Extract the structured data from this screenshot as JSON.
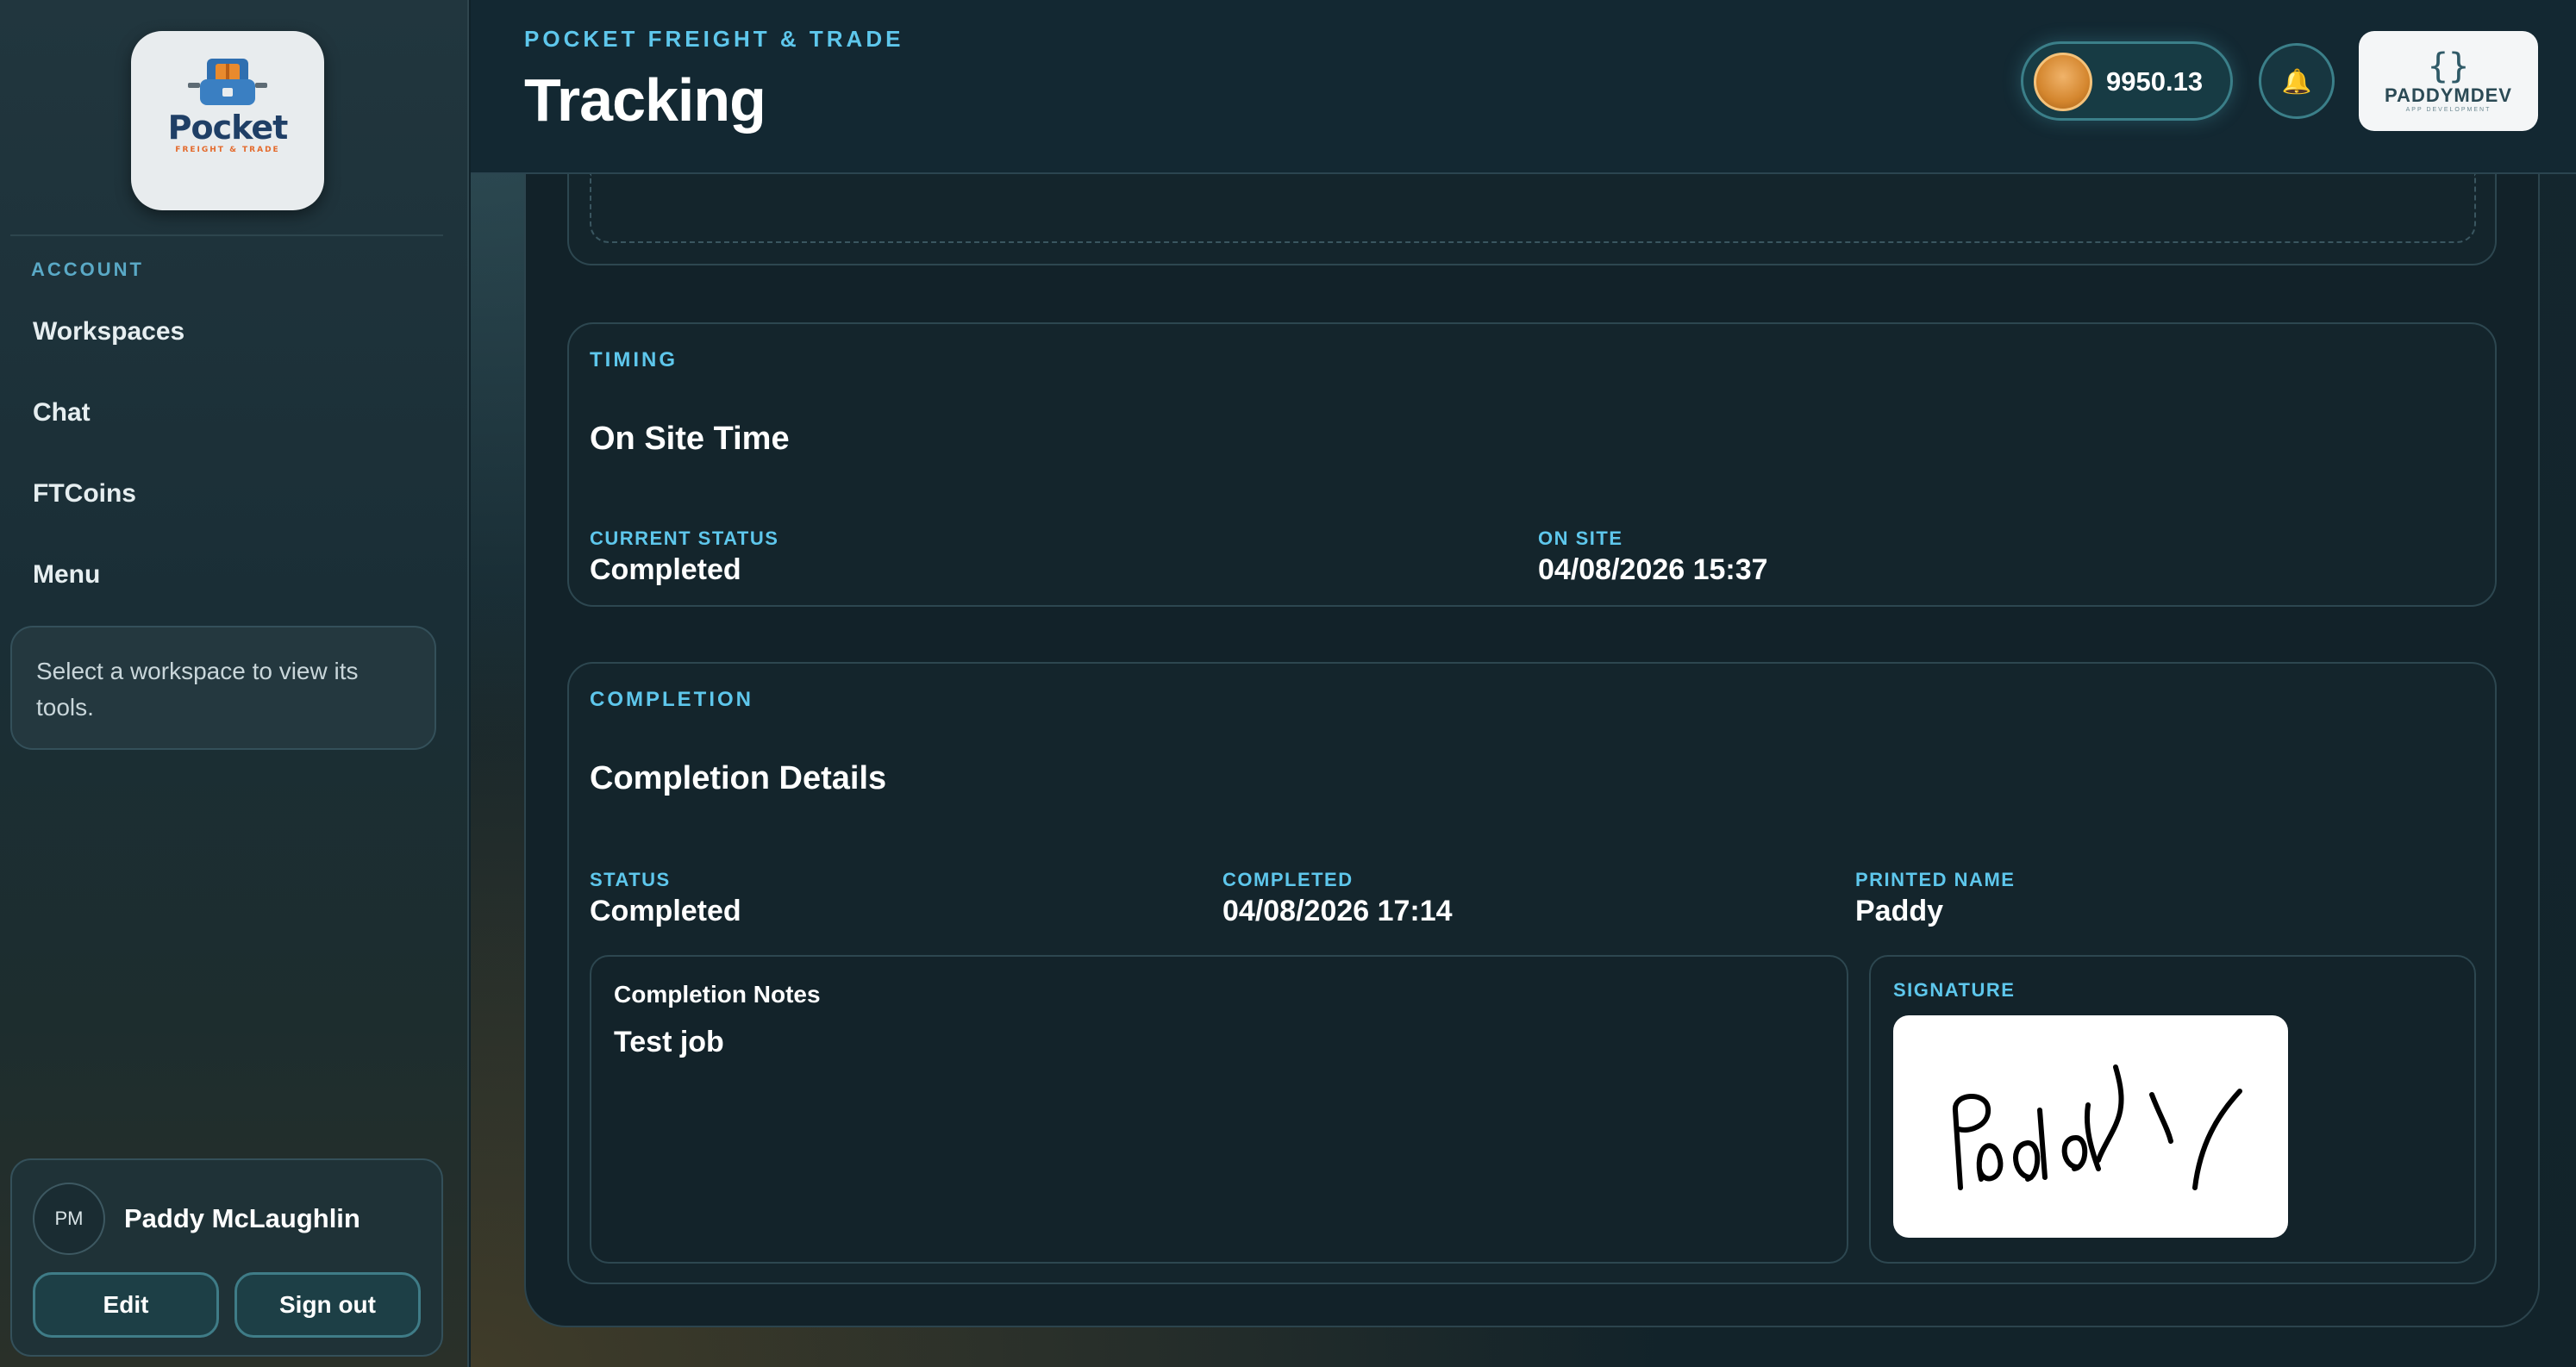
{
  "colors": {
    "accent": "#5ec7ec",
    "panel": "#14252c",
    "border": "#2d4750",
    "sidebar": "#1f333b"
  },
  "sidebar": {
    "logo": {
      "word": "Pocket",
      "sub": "FREIGHT & TRADE"
    },
    "section_label": "ACCOUNT",
    "items": [
      {
        "label": "Workspaces"
      },
      {
        "label": "Chat"
      },
      {
        "label": "FTCoins"
      },
      {
        "label": "Menu"
      }
    ],
    "hint": "Select a workspace to view its tools.",
    "user": {
      "initials": "PM",
      "name": "Paddy McLaughlin",
      "edit_label": "Edit",
      "signout_label": "Sign out"
    }
  },
  "header": {
    "brand": "POCKET FREIGHT & TRADE",
    "title": "Tracking",
    "coins": "9950.13",
    "bell_icon": "bell-icon",
    "dev_logo": {
      "name": "PADDYMDEV",
      "sub": "APP DEVELOPMENT"
    }
  },
  "timing": {
    "label": "TIMING",
    "title": "On Site Time",
    "fields": [
      {
        "label": "CURRENT STATUS",
        "value": "Completed"
      },
      {
        "label": "ON SITE",
        "value": "04/08/2026 15:37"
      }
    ]
  },
  "completion": {
    "label": "COMPLETION",
    "title": "Completion Details",
    "fields": [
      {
        "label": "STATUS",
        "value": "Completed"
      },
      {
        "label": "COMPLETED",
        "value": "04/08/2026 17:14"
      },
      {
        "label": "PRINTED NAME",
        "value": "Paddy"
      }
    ],
    "notes_title": "Completion Notes",
    "notes_body": "Test job",
    "signature_label": "SIGNATURE"
  }
}
